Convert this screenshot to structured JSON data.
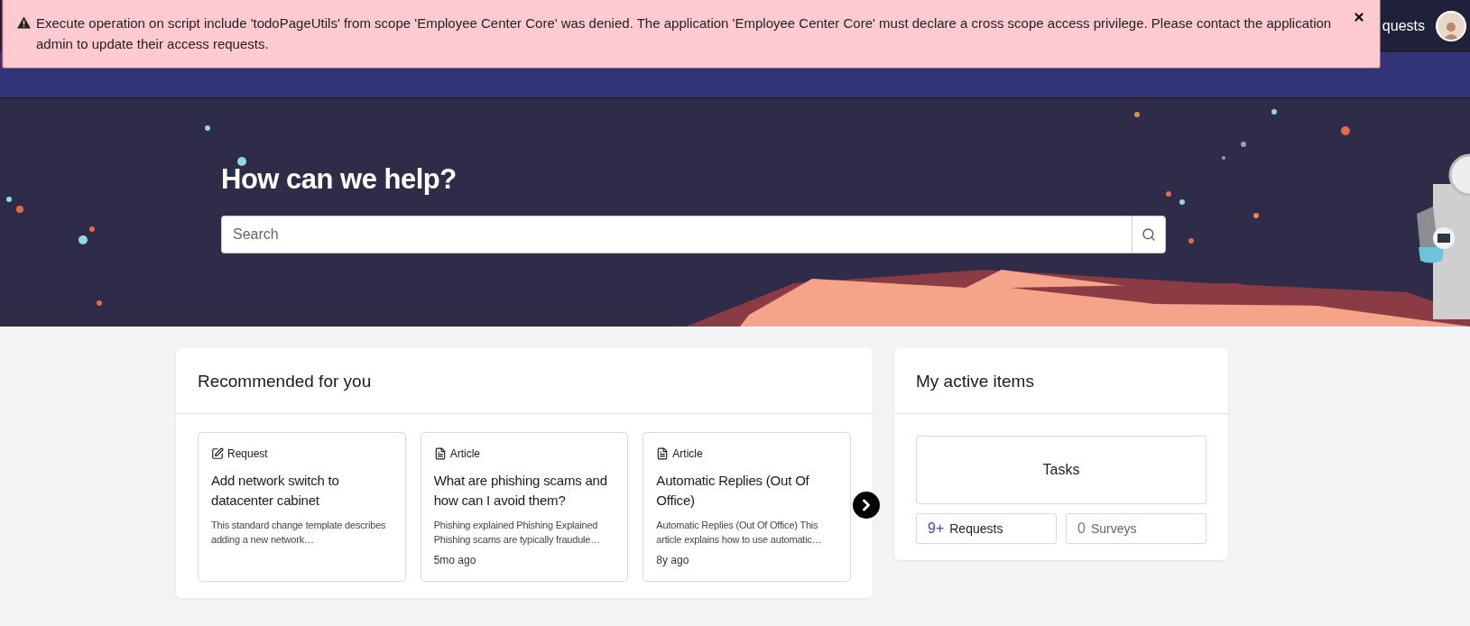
{
  "alert": {
    "message": "Execute operation on script include 'todoPageUtils' from scope 'Employee Center Core' was denied. The application 'Employee Center Core' must declare a cross scope access privilege. Please contact the application admin to update their access requests."
  },
  "header": {
    "nav_link": "quests"
  },
  "hero": {
    "title": "How can we help?",
    "search": {
      "placeholder": "Search"
    }
  },
  "recommended": {
    "title": "Recommended for you",
    "items": [
      {
        "kind": "request",
        "type_label": "Request",
        "title": "Add network switch to datacenter cabinet",
        "description": "This standard change template describes adding a new network…"
      },
      {
        "kind": "article",
        "type_label": "Article",
        "title": "What are phishing scams and how can I avoid them?",
        "description": "Phishing explained Phishing Explained Phishing scams are typically fraudule…",
        "age": "5mo ago"
      },
      {
        "kind": "article",
        "type_label": "Article",
        "title": "Automatic Replies (Out Of Office)",
        "description": "Automatic Replies (Out Of Office) This article explains how to use automatic…",
        "age": "8y ago"
      }
    ]
  },
  "active_items": {
    "title": "My active items",
    "tasks": "Tasks",
    "counters": [
      {
        "count": "9+",
        "label": "Requests",
        "highlighted": true
      },
      {
        "count": "0",
        "label": "Surveys",
        "highlighted": false
      }
    ]
  }
}
